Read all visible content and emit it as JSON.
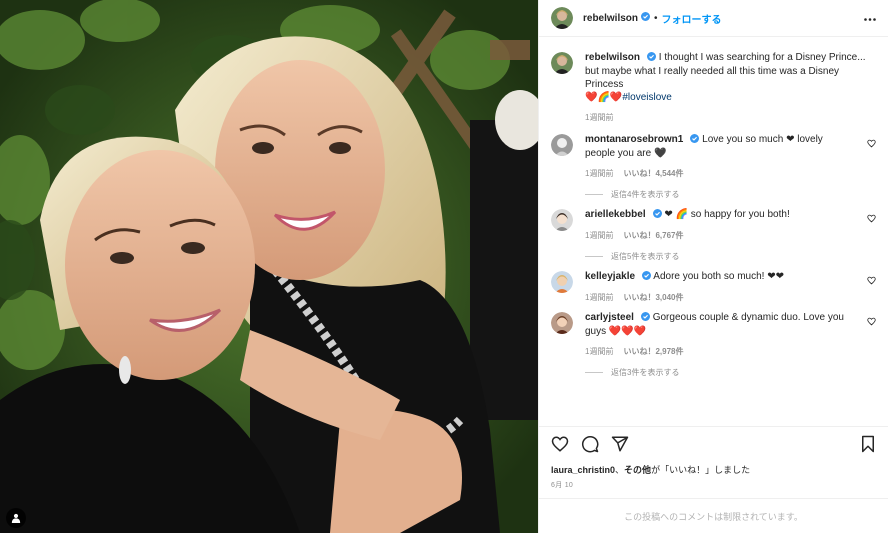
{
  "post": {
    "username": "rebelwilson",
    "follow_label": "フォローする",
    "dot": "•",
    "caption": "I thought I was searching for a Disney Prince... but maybe what I really needed all this time was a Disney Princess",
    "caption_emoji": "❤️🌈❤️",
    "hashtag": "#loveislove",
    "time": "1週間前"
  },
  "comments": [
    {
      "username": "montanarosebrown1",
      "text": "Love you so much ❤ lovely people you are 🖤",
      "time": "1週間前",
      "likes": "いいね！4,544件",
      "replies": "返信4件を表示する"
    },
    {
      "username": "ariellekebbel",
      "text": "❤ 🌈 so happy for you both!",
      "time": "1週間前",
      "likes": "いいね！6,767件",
      "replies": "返信5件を表示する"
    },
    {
      "username": "kelleyjakle",
      "text": "Adore you both so much! ❤❤",
      "time": "1週間前",
      "likes": "いいね！3,040件",
      "replies": ""
    },
    {
      "username": "carlyjsteel",
      "text": "Gorgeous couple & dynamic duo. Love you guys ❤️❤️❤️",
      "time": "1週間前",
      "likes": "いいね！2,978件",
      "replies": "返信3件を表示する"
    }
  ],
  "liked_by": {
    "user": "laura_christin0",
    "sep": "、",
    "others": "その他",
    "suffix": "が「いいね！」しました"
  },
  "date": "6月 10",
  "comments_restricted": "この投稿へのコメントは制限されています。",
  "icons": {
    "heart": "heart-icon",
    "comment": "comment-icon",
    "share": "share-icon",
    "save": "bookmark-icon",
    "more": "more-icon",
    "verified": "verified-badge-icon",
    "user_tag": "user-tag-icon"
  },
  "colors": {
    "link": "#0095f6",
    "hashtag": "#00376b",
    "muted": "#8e8e8e"
  }
}
